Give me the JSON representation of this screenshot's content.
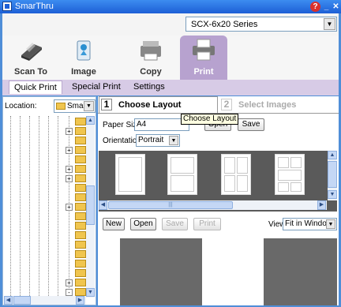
{
  "window": {
    "title": "SmarThru"
  },
  "model": {
    "selected": "SCX-6x20 Series"
  },
  "toolbar": {
    "buttons": [
      {
        "label": "Scan To"
      },
      {
        "label": "Image"
      },
      {
        "label": "Copy"
      },
      {
        "label": "Print"
      }
    ]
  },
  "subtabs": [
    "Quick Print",
    "Special Print",
    "Settings"
  ],
  "left": {
    "location_label": "Location:",
    "location_value": "Smar"
  },
  "steps": {
    "step1_num": "1",
    "step1_label": "Choose Layout",
    "step2_num": "2",
    "step2_label": "Select Images"
  },
  "tooltip": "Choose Layout",
  "paper": {
    "size_label": "Paper Size",
    "size_value": "A4",
    "open_label": "Open",
    "save_label": "Save",
    "orientation_label": "Orientation",
    "orientation_value": "Portrait"
  },
  "bottom": {
    "new_label": "New",
    "open_label": "Open",
    "save_label": "Save",
    "print_label": "Print",
    "view_label": "View",
    "view_value": "Fit in Window"
  },
  "colors": {
    "accent": "#b7a2cf",
    "titlebar": "#1d5fd6",
    "frame": "#4f8ed8"
  }
}
